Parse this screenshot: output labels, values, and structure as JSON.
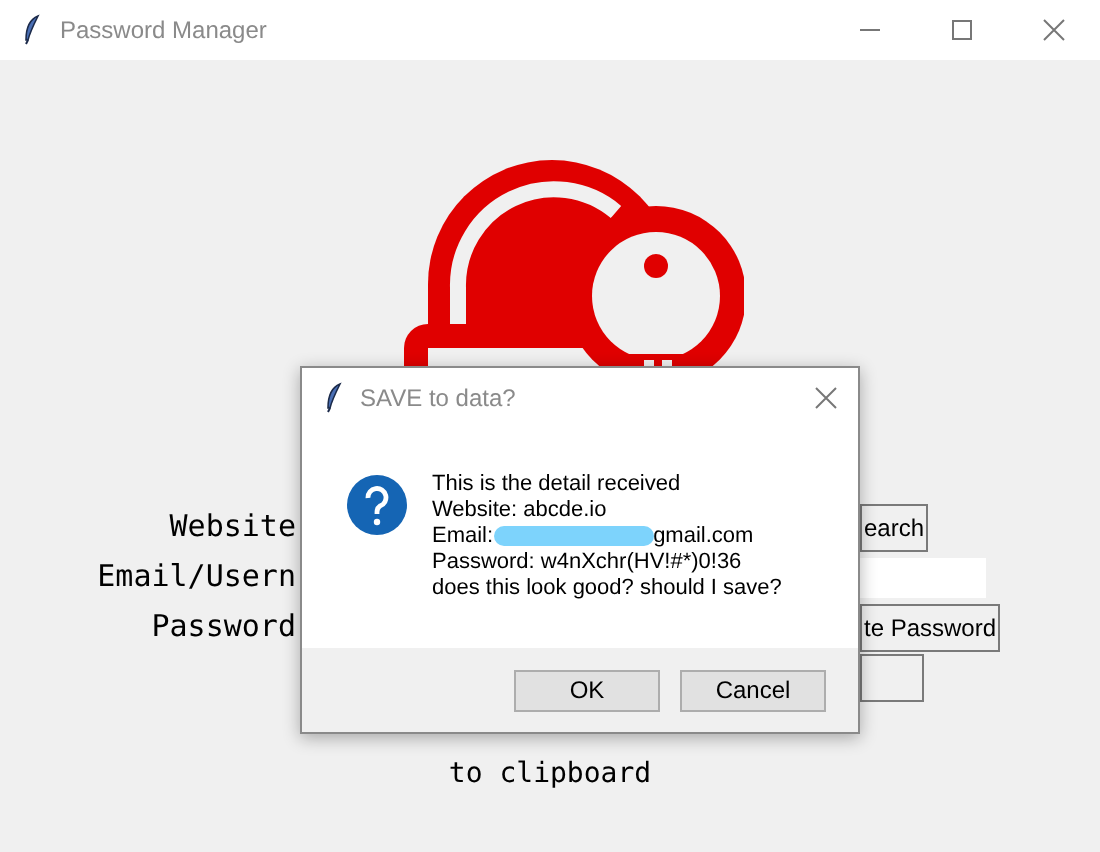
{
  "window": {
    "title": "Password Manager"
  },
  "form": {
    "labels": [
      "Website",
      "Email/Usern",
      "Password"
    ]
  },
  "side_controls": [
    {
      "kind": "button",
      "label": "earch"
    },
    {
      "kind": "field"
    },
    {
      "kind": "button",
      "label": "te Password"
    },
    {
      "kind": "button"
    }
  ],
  "status_lines": [
    "to clipboard"
  ],
  "dialog": {
    "title": "SAVE to data?",
    "lines": [
      {
        "kind": "text",
        "text": "This is the detail received"
      },
      {
        "kind": "text",
        "text": "Website: abcde.io"
      },
      {
        "kind": "redacted",
        "text": "Email:",
        "after": "gmail.com"
      },
      {
        "kind": "text",
        "text": "Password: w4nXchr(HV!#*)0!36"
      },
      {
        "kind": "text",
        "text": "does this look good? should I save?"
      }
    ],
    "buttons": [
      "OK",
      "Cancel"
    ]
  }
}
